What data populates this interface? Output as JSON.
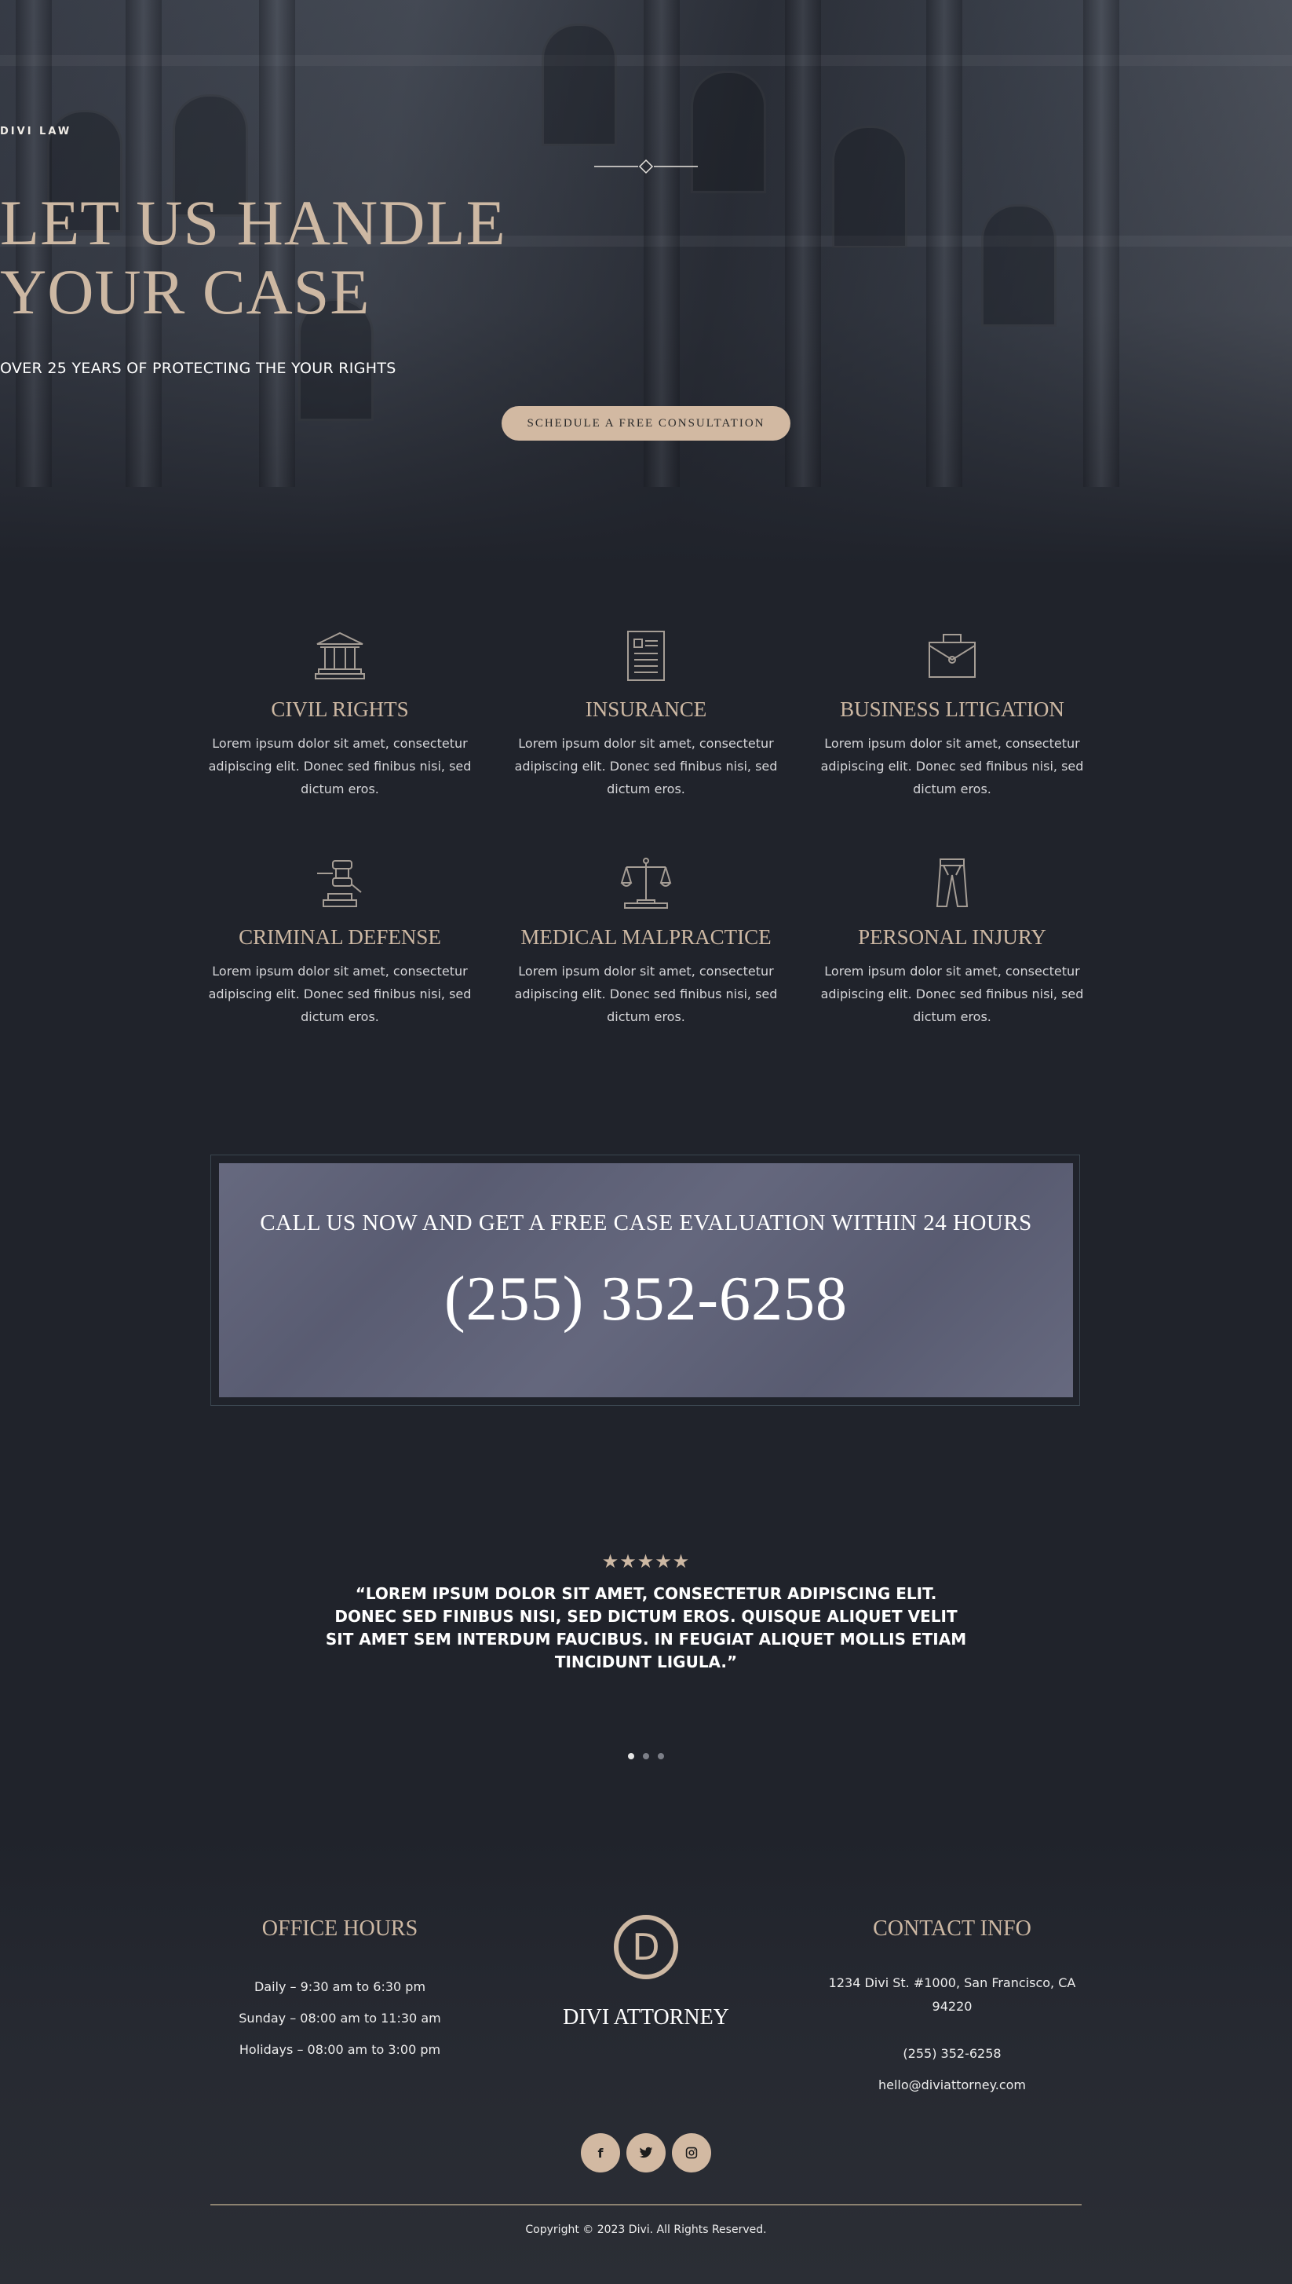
{
  "colors": {
    "background": "#20232b",
    "accent": "#cdb8a3",
    "button": "#d2b9a2",
    "callbox": "#5e6178"
  },
  "hero": {
    "eyebrow": "DIVI LAW",
    "title_line1": "LET US HANDLE",
    "title_line2": "YOUR CASE",
    "subtitle": "OVER 25 YEARS OF PROTECTING THE YOUR RIGHTS",
    "cta_label": "SCHEDULE A FREE CONSULTATION"
  },
  "services": [
    {
      "icon": "courthouse-icon",
      "title": "CIVIL RIGHTS",
      "text": "Lorem ipsum dolor sit amet, consectetur adipiscing elit. Donec sed finibus nisi, sed dictum eros."
    },
    {
      "icon": "document-icon",
      "title": "INSURANCE",
      "text": "Lorem ipsum dolor sit amet, consectetur adipiscing elit. Donec sed finibus nisi, sed dictum eros."
    },
    {
      "icon": "briefcase-icon",
      "title": "BUSINESS LITIGATION",
      "text": "Lorem ipsum dolor sit amet, consectetur adipiscing elit. Donec sed finibus nisi, sed dictum eros."
    },
    {
      "icon": "gavel-icon",
      "title": "CRIMINAL DEFENSE",
      "text": "Lorem ipsum dolor sit amet, consectetur adipiscing elit. Donec sed finibus nisi, sed dictum eros."
    },
    {
      "icon": "scales-icon",
      "title": "MEDICAL MALPRACTICE",
      "text": "Lorem ipsum dolor sit amet, consectetur adipiscing elit. Donec sed finibus nisi, sed dictum eros."
    },
    {
      "icon": "trousers-icon",
      "title": "PERSONAL INJURY",
      "text": "Lorem ipsum dolor sit amet, consectetur adipiscing elit. Donec sed finibus nisi, sed dictum eros."
    }
  ],
  "call": {
    "line": "CALL US NOW AND GET A FREE CASE EVALUATION WITHIN 24 HOURS",
    "phone": "(255) 352-6258"
  },
  "testimonial": {
    "stars": "★★★★★",
    "rating": 5,
    "quote": "“LOREM IPSUM DOLOR SIT AMET, CONSECTETUR ADIPISCING ELIT. DONEC SED FINIBUS NISI, SED DICTUM EROS. QUISQUE ALIQUET VELIT SIT AMET SEM INTERDUM FAUCIBUS. IN FEUGIAT ALIQUET MOLLIS ETIAM TINCIDUNT LIGULA.”",
    "slides": 3,
    "active_slide": 1
  },
  "footer": {
    "office_title": "OFFICE HOURS",
    "hours": [
      "Daily – 9:30 am to 6:30 pm",
      "Sunday – 08:00 am to 11:30 am",
      "Holidays – 08:00 am to 3:00 pm"
    ],
    "logo_letter": "D",
    "brand": "DIVI ATTORNEY",
    "contact_title": "CONTACT INFO",
    "address_line1": "1234 Divi St. #1000, San Francisco, CA",
    "address_line2": "94220",
    "phone": "(255) 352-6258",
    "email": "hello@diviattorney.com",
    "socials": [
      {
        "icon": "facebook-icon",
        "glyph": "f"
      },
      {
        "icon": "twitter-icon",
        "glyph": "🐦"
      },
      {
        "icon": "instagram-icon",
        "glyph": "◎"
      }
    ],
    "copyright": "Copyright © 2023 Divi. All Rights Reserved."
  }
}
